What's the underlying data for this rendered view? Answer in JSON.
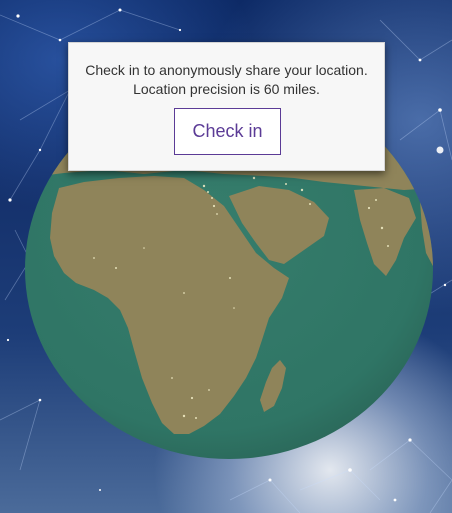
{
  "dialog": {
    "line1": "Check in to anonymously share your location.",
    "line2": "Location precision is 60 miles.",
    "button_label": "Check in"
  },
  "colors": {
    "accent": "#5b3b96",
    "ocean": "#2f7565",
    "land": "#8f845a",
    "dialog_bg": "#f7f7f7"
  },
  "icons": {
    "globe": "globe-illustration",
    "background": "starfield-network"
  }
}
